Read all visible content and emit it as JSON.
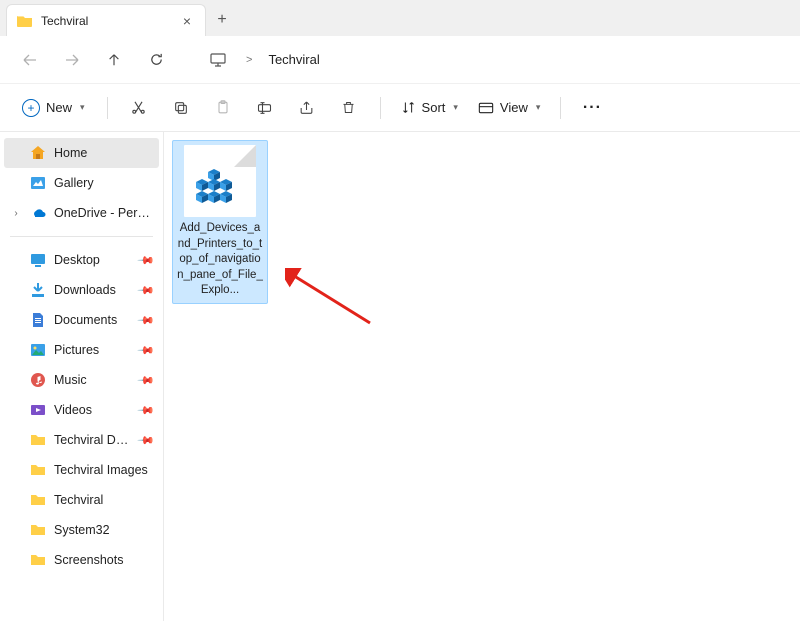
{
  "tab": {
    "title": "Techviral",
    "close": "×",
    "new": "+"
  },
  "address": {
    "monitor": "🖥",
    "sep": ">",
    "path": "Techviral"
  },
  "toolbar": {
    "new_label": "New",
    "sort_label": "Sort",
    "view_label": "View",
    "more": "···"
  },
  "sidebar": {
    "home": "Home",
    "gallery": "Gallery",
    "onedrive": "OneDrive - Persona",
    "quick": [
      {
        "label": "Desktop"
      },
      {
        "label": "Downloads"
      },
      {
        "label": "Documents"
      },
      {
        "label": "Pictures"
      },
      {
        "label": "Music"
      },
      {
        "label": "Videos"
      },
      {
        "label": "Techviral Docum"
      },
      {
        "label": "Techviral Images"
      },
      {
        "label": "Techviral"
      },
      {
        "label": "System32"
      },
      {
        "label": "Screenshots"
      }
    ]
  },
  "file": {
    "name": "Add_Devices_and_Printers_to_top_of_navigation_pane_of_File_Explo..."
  }
}
